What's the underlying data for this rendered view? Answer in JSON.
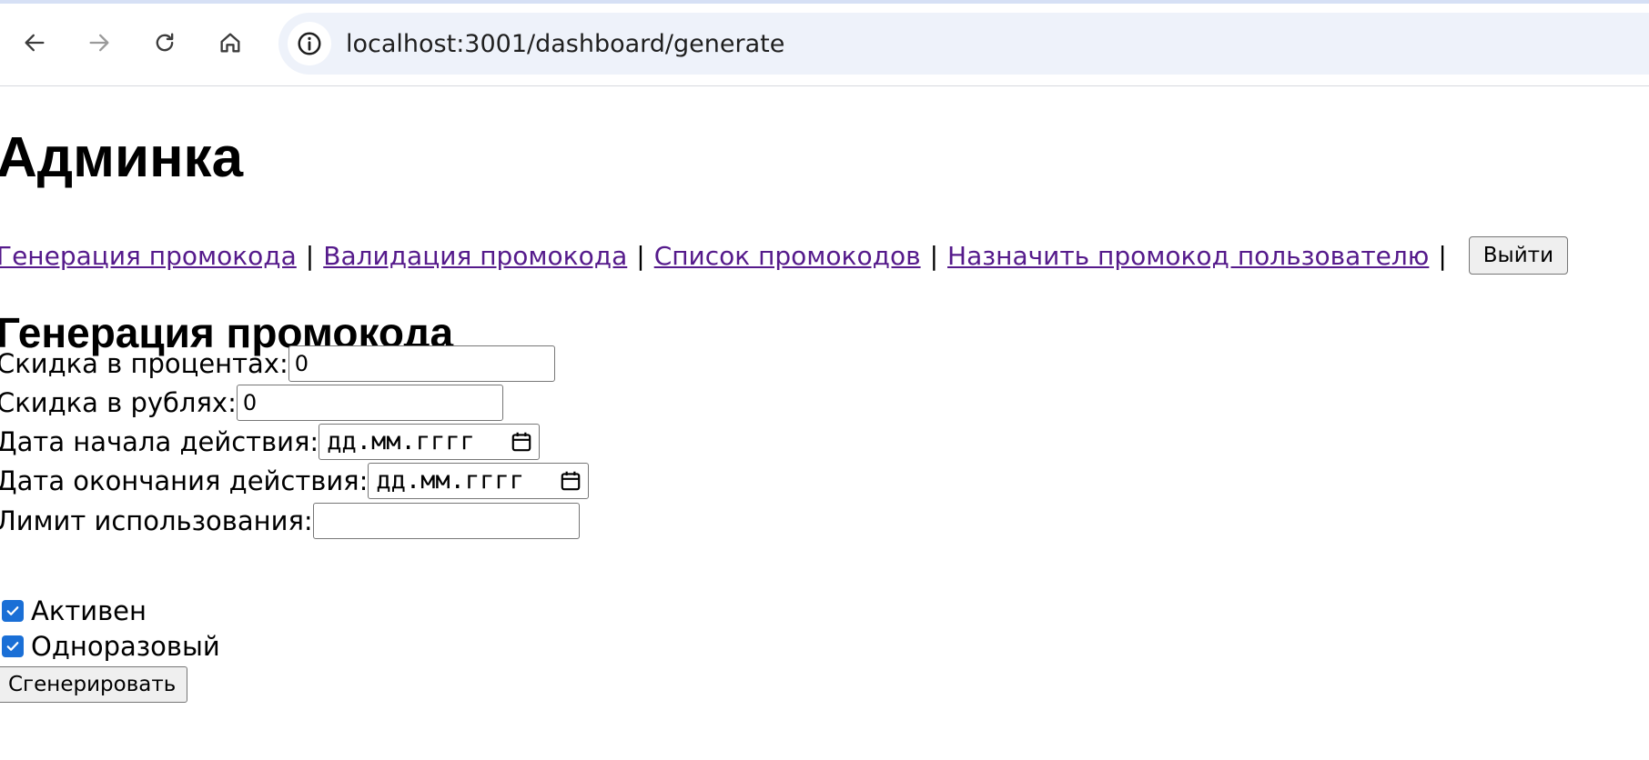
{
  "browser": {
    "url": "localhost:3001/dashboard/generate",
    "icons": [
      "back-arrow-icon",
      "forward-arrow-icon",
      "reload-icon",
      "home-icon",
      "site-info-icon"
    ]
  },
  "page": {
    "title": "Админка",
    "nav": {
      "links": [
        "Генерация промокода",
        "Валидация промокода",
        "Список промокодов",
        "Назначить промокод пользователю"
      ],
      "separator": "|",
      "logout_label": "Выйти"
    },
    "section_title": "Генерация промокода",
    "form": {
      "percent_label": "Скидка в процентах:",
      "percent_value": "0",
      "rub_label": "Скидка в рублях:",
      "rub_value": "0",
      "start_label": "Дата начала действия:",
      "start_placeholder": "дд.мм.гггг",
      "end_label": "Дата окончания действия:",
      "end_placeholder": "дд.мм.гггг",
      "limit_label": "Лимит использования:",
      "limit_value": "",
      "active_label": "Активен",
      "active_checked": true,
      "single_use_label": "Одноразовый",
      "single_use_checked": true,
      "submit_label": "Сгенерировать"
    }
  },
  "colors": {
    "link": "#551a8b",
    "checkbox": "#1a6fd6",
    "urlbar": "#eef2fa"
  }
}
